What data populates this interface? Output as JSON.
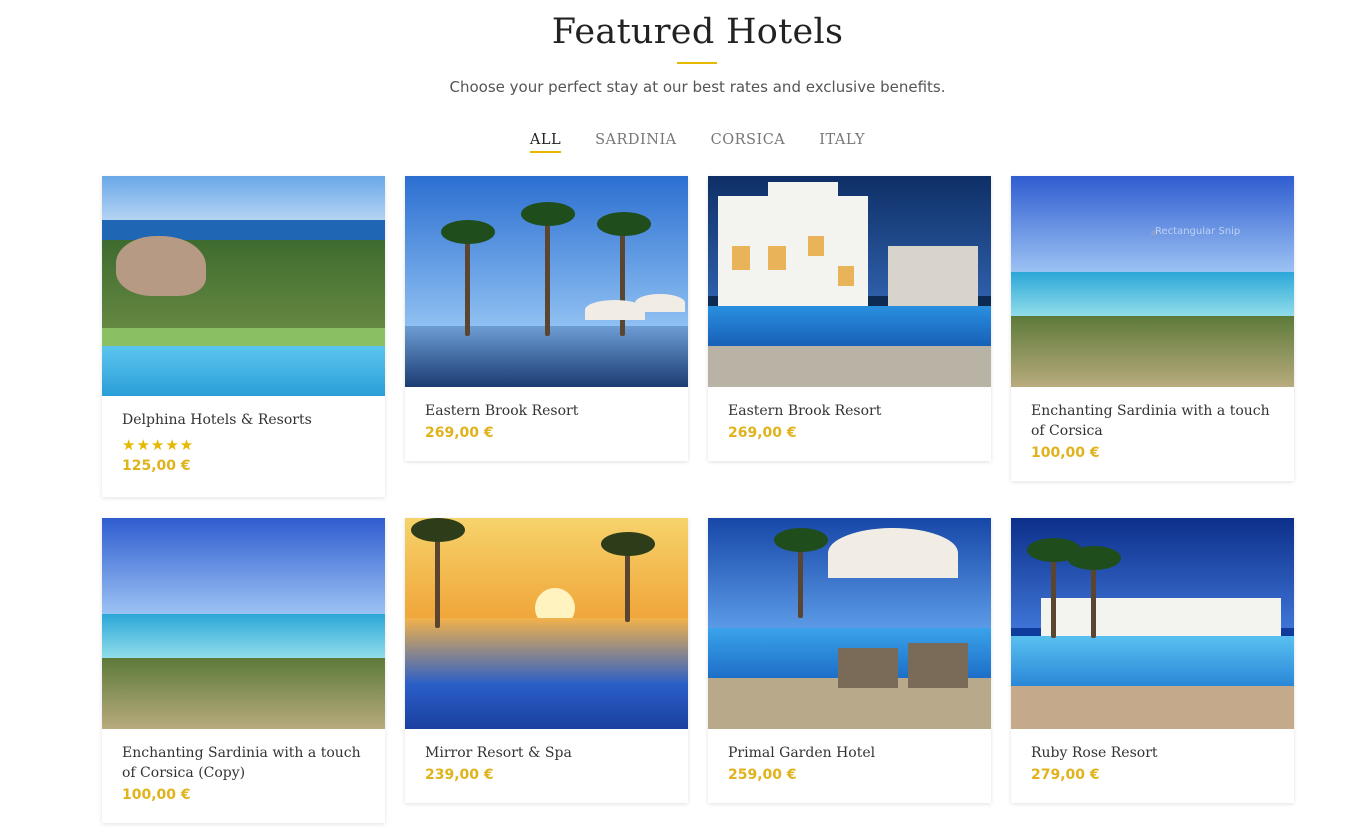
{
  "header": {
    "title": "Featured Hotels",
    "subtitle": "Choose your perfect stay at our best rates and exclusive benefits."
  },
  "tabs": [
    {
      "label": "ALL",
      "active": true
    },
    {
      "label": "SARDINIA",
      "active": false
    },
    {
      "label": "CORSICA",
      "active": false
    },
    {
      "label": "ITALY",
      "active": false
    }
  ],
  "hotels": [
    {
      "name": "Delphina Hotels & Resorts",
      "rating": 5,
      "price": "125,00 €"
    },
    {
      "name": "Eastern Brook Resort",
      "price": "269,00 €"
    },
    {
      "name": "Eastern Brook Resort",
      "price": "269,00 €"
    },
    {
      "name": "Enchanting Sardinia with a touch of Corsica",
      "price": "100,00 €"
    },
    {
      "name": "Enchanting Sardinia with a touch of Corsica (Copy)",
      "price": "100,00 €"
    },
    {
      "name": "Mirror Resort & Spa",
      "price": "239,00 €"
    },
    {
      "name": "Primal Garden Hotel",
      "price": "259,00 €"
    },
    {
      "name": "Ruby Rose Resort",
      "price": "279,00 €"
    }
  ],
  "overlay": {
    "watermark": "Rectangular Snip"
  },
  "colors": {
    "accent": "#e6b800",
    "price": "#e0b21b"
  }
}
